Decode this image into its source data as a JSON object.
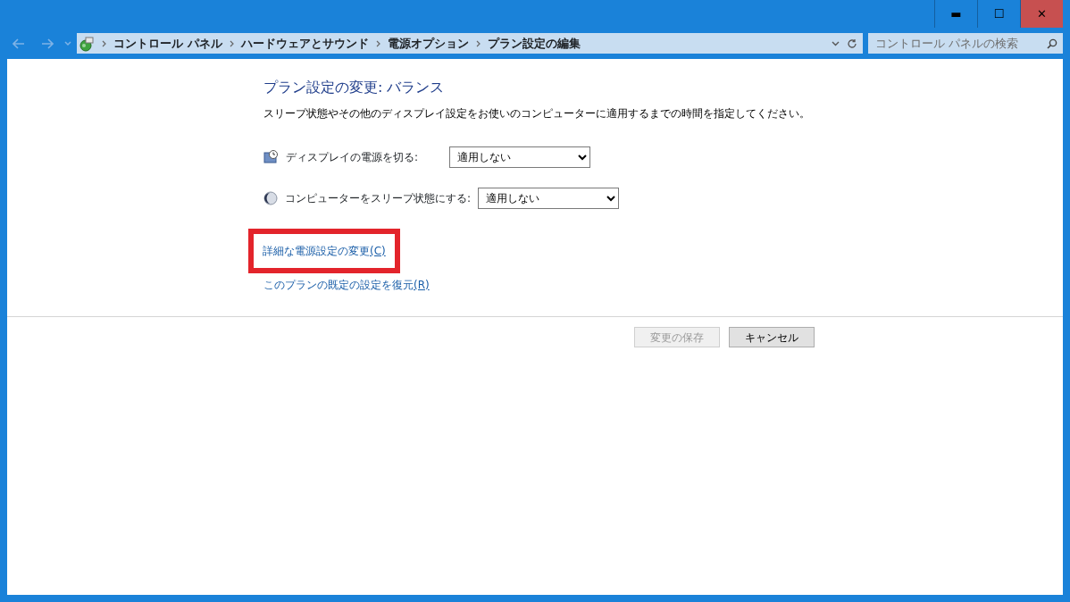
{
  "window": {
    "controls": [
      {
        "kind": "minimize",
        "glyph": "▬"
      },
      {
        "kind": "maximize",
        "glyph": "☐"
      },
      {
        "kind": "close",
        "glyph": "✕"
      }
    ]
  },
  "nav": {
    "back_disabled": true,
    "forward_disabled": true
  },
  "breadcrumb": [
    "コントロール パネル",
    "ハードウェアとサウンド",
    "電源オプション",
    "プラン設定の編集"
  ],
  "search": {
    "placeholder": "コントロール パネルの検索"
  },
  "heading": "プラン設定の変更: バランス",
  "description": "スリープ状態やその他のディスプレイ設定をお使いのコンピューターに適用するまでの時間を指定してください。",
  "settings": [
    {
      "kind": "display",
      "label": "ディスプレイの電源を切る:",
      "value": "適用しない"
    },
    {
      "kind": "sleep",
      "label": "コンピューターをスリープ状態にする:",
      "value": "適用しない"
    }
  ],
  "links": [
    {
      "text": "詳細な電源設定の変更",
      "accesskey": "(C)",
      "highlighted": true
    },
    {
      "text": "このプランの既定の設定を復元",
      "accesskey": "(R)",
      "highlighted": false
    }
  ],
  "buttons": [
    {
      "label": "変更の保存",
      "disabled": true
    },
    {
      "label": "キャンセル",
      "disabled": false
    }
  ]
}
